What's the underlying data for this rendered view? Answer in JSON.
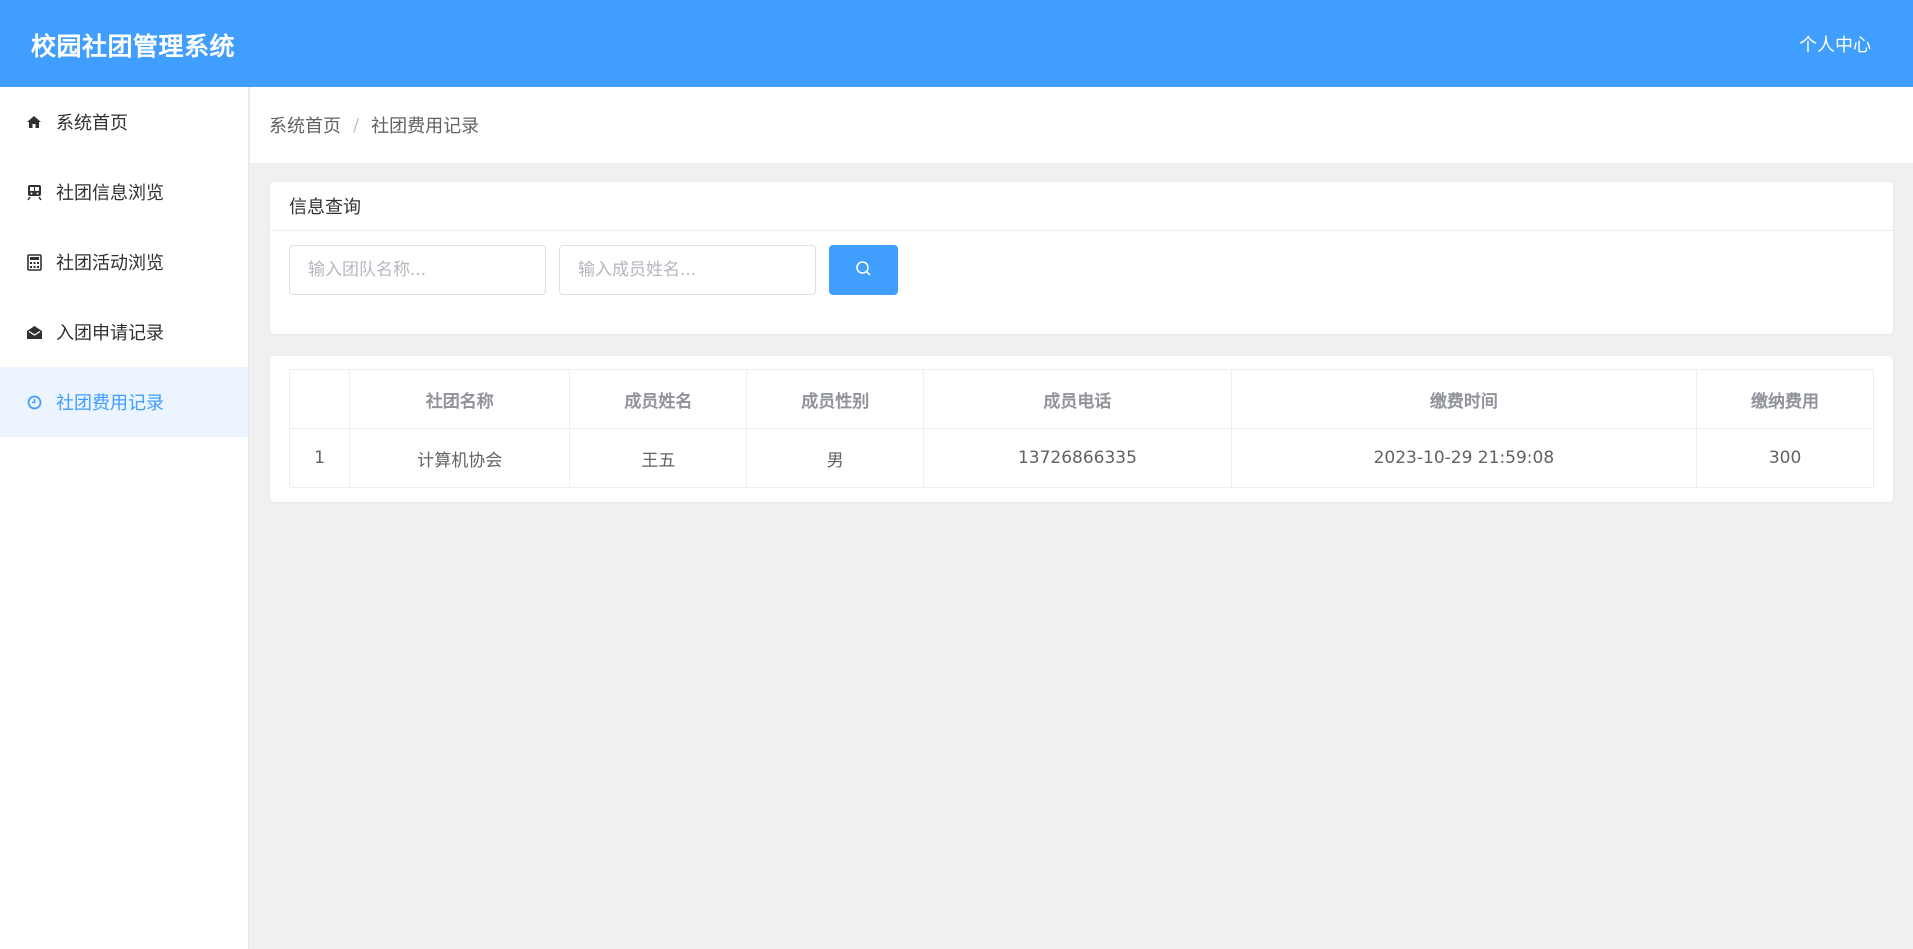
{
  "header": {
    "title": "校园社团管理系统",
    "user_center": "个人中心"
  },
  "sidebar": {
    "items": [
      {
        "label": "系统首页",
        "icon": "home-icon"
      },
      {
        "label": "社团信息浏览",
        "icon": "train-icon"
      },
      {
        "label": "社团活动浏览",
        "icon": "calculator-icon"
      },
      {
        "label": "入团申请记录",
        "icon": "envelope-open-icon"
      },
      {
        "label": "社团费用记录",
        "icon": "clock-icon",
        "active": true
      }
    ]
  },
  "breadcrumb": {
    "home": "系统首页",
    "separator": "/",
    "current": "社团费用记录"
  },
  "search": {
    "title": "信息查询",
    "team_placeholder": "输入团队名称...",
    "member_placeholder": "输入成员姓名..."
  },
  "table": {
    "headers": [
      "",
      "社团名称",
      "成员姓名",
      "成员性别",
      "成员电话",
      "缴费时间",
      "缴纳费用"
    ],
    "rows": [
      [
        "1",
        "计算机协会",
        "王五",
        "男",
        "13726866335",
        "2023-10-29 21:59:08",
        "300"
      ]
    ]
  },
  "colors": {
    "primary": "#409eff",
    "active_bg": "#ecf5ff"
  }
}
